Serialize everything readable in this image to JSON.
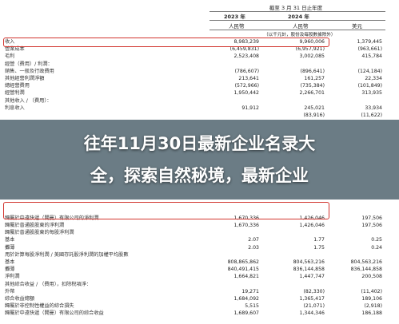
{
  "header": {
    "title": "截至 3 月 31 日止年度",
    "year_2023": "2023 年",
    "year_2024": "2024 年",
    "cur_1": "人民幣",
    "cur_2": "人民幣",
    "cur_3": "美元",
    "unit_note": "（以千元計，股份及每股數據除外）"
  },
  "rows": [
    {
      "label": "收入",
      "v1": "8,983,239",
      "v2": "9,960,006",
      "v3": "1,379,445"
    },
    {
      "label": "營業成本",
      "v1": "(6,459,831)",
      "v2": "(6,957,921)",
      "v3": "(963,661)"
    },
    {
      "label": "毛利",
      "v1": "2,523,408",
      "v2": "3,002,085",
      "v3": "415,784"
    },
    {
      "label": "經營（費用）/ 利潤：",
      "v1": "",
      "v2": "",
      "v3": ""
    },
    {
      "label": "銷售、一般及行政費用",
      "v1": "(786,607)",
      "v2": "(896,641)",
      "v3": "(124,184)"
    },
    {
      "label": "其他經營利潤淨額",
      "v1": "213,641",
      "v2": "161,257",
      "v3": "22,334"
    },
    {
      "label": "總經營費用",
      "v1": "(572,966)",
      "v2": "(735,384)",
      "v3": "(101,849)"
    },
    {
      "label": "經營利潤",
      "v1": "1,950,442",
      "v2": "2,266,701",
      "v3": "313,935"
    },
    {
      "label": "其他收入 / （費用）：",
      "v1": "",
      "v2": "",
      "v3": ""
    },
    {
      "label": "利息收入",
      "v1": "91,912",
      "v2": "245,021",
      "v3": "33,934"
    },
    {
      "label": "",
      "v1": "",
      "v2": "(83,916)",
      "v3": "(11,622)"
    },
    {
      "label": "",
      "v1": "",
      "v2": "",
      "v3": ""
    },
    {
      "label": "",
      "v1": "",
      "v2": "",
      "v3": ""
    },
    {
      "label": "",
      "v1": "",
      "v2": "",
      "v3": ""
    },
    {
      "label": "",
      "v1": "",
      "v2": "",
      "v3": ""
    },
    {
      "label": "",
      "v1": "",
      "v2": "",
      "v3": ""
    },
    {
      "label": "",
      "v1": "",
      "v2": "",
      "v3": ""
    },
    {
      "label": "",
      "v1": "",
      "v2": "",
      "v3": ""
    },
    {
      "label": "",
      "v1": "",
      "v2": "",
      "v3": ""
    },
    {
      "label": "",
      "v1": "",
      "v2": "",
      "v3": ""
    },
    {
      "label": "",
      "v1": "",
      "v2": "",
      "v3": ""
    },
    {
      "label": "",
      "v1": "",
      "v2": "",
      "v3": ""
    },
    {
      "label": "",
      "v1": "",
      "v2": "",
      "v3": ""
    },
    {
      "label": "",
      "v1": "",
      "v2": "",
      "v3": ""
    },
    {
      "label": "歸屬於中遠快遞（開曼）有限公司的淨利潤",
      "v1": "1,670,336",
      "v2": "1,426,046",
      "v3": "197,506"
    },
    {
      "label": "歸屬於普通股股東的淨利潤",
      "v1": "1,670,336",
      "v2": "1,426,046",
      "v3": "197,506"
    },
    {
      "label": "歸屬於普通股股東的每股淨利潤",
      "v1": "",
      "v2": "",
      "v3": ""
    },
    {
      "label": "基本",
      "v1": "2.07",
      "v2": "1.77",
      "v3": "0.25"
    },
    {
      "label": "攤薄",
      "v1": "2.03",
      "v2": "1.75",
      "v3": "0.24"
    },
    {
      "label": "用於計算每股淨利潤 / 美國存託股淨利潤的加權平均股數",
      "v1": "",
      "v2": "",
      "v3": ""
    },
    {
      "label": "基本",
      "v1": "808,865,862",
      "v2": "804,563,216",
      "v3": "804,563,216"
    },
    {
      "label": "攤薄",
      "v1": "840,491,415",
      "v2": "836,144,858",
      "v3": "836,144,858"
    },
    {
      "label": "淨利潤",
      "v1": "1,664,821",
      "v2": "1,447,747",
      "v3": "200,508"
    },
    {
      "label": "其他綜合收益 / （費用），扣除稅項淨：",
      "v1": "",
      "v2": "",
      "v3": ""
    },
    {
      "label": "外幣",
      "v1": "19,271",
      "v2": "(82,330)",
      "v3": "(11,402)"
    },
    {
      "label": "綜合收益總額",
      "v1": "1,684,092",
      "v2": "1,365,417",
      "v3": "189,106"
    },
    {
      "label": "歸屬於非控制性權益的綜合損失",
      "v1": "5,515",
      "v2": "(21,071)",
      "v3": "(2,918)"
    },
    {
      "label": "歸屬於中遠快遞（開曼）有限公司的綜合收益",
      "v1": "1,689,607",
      "v2": "1,344,346",
      "v3": "186,188"
    }
  ],
  "overlay": {
    "line1": "往年11月30日最新企业名录大",
    "line2": "全，探索自然秘境，最新企业"
  },
  "colors": {
    "highlight": "#d2352f",
    "band": "#102c3a"
  }
}
